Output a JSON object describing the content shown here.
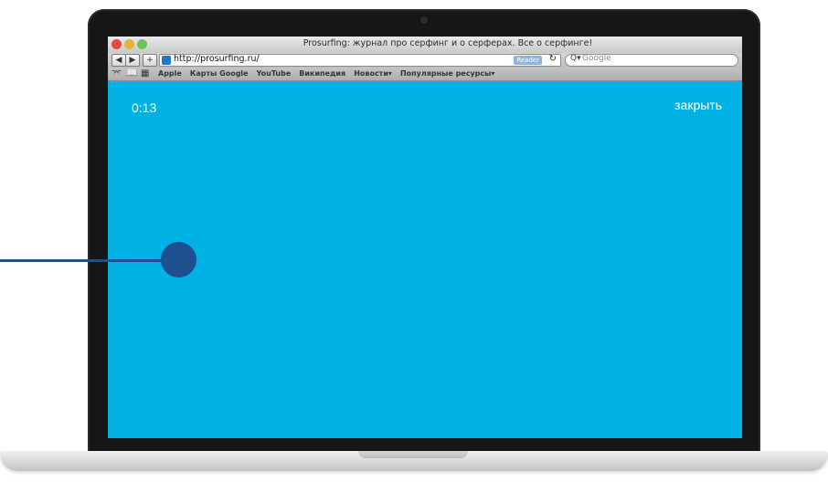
{
  "browser": {
    "window_title": "Prosurfing: журнал про серфинг и о серферах. Все о серфинге!",
    "url": "http://prosurfing.ru/",
    "reader_label": "Reader",
    "search_placeholder": "Google",
    "nav": {
      "back": "◀",
      "forward": "▶",
      "add": "+",
      "reload": "↻"
    }
  },
  "bookmarks": {
    "items": [
      "Apple",
      "Карты Google",
      "YouTube",
      "Википедия",
      "Новости▾",
      "Популярные ресурсы▾"
    ]
  },
  "page": {
    "timer": "0:13",
    "close_label": "закрыть",
    "background_color": "#00b1e6"
  },
  "icons": {
    "reading_list": "reading-list-icon",
    "book": "bookmarks-book-icon",
    "grid": "top-sites-grid-icon",
    "search": "search-icon",
    "favicon": "site-favicon-icon"
  },
  "colors": {
    "pointer": "#1d4f91",
    "screen": "#00b1e6"
  }
}
